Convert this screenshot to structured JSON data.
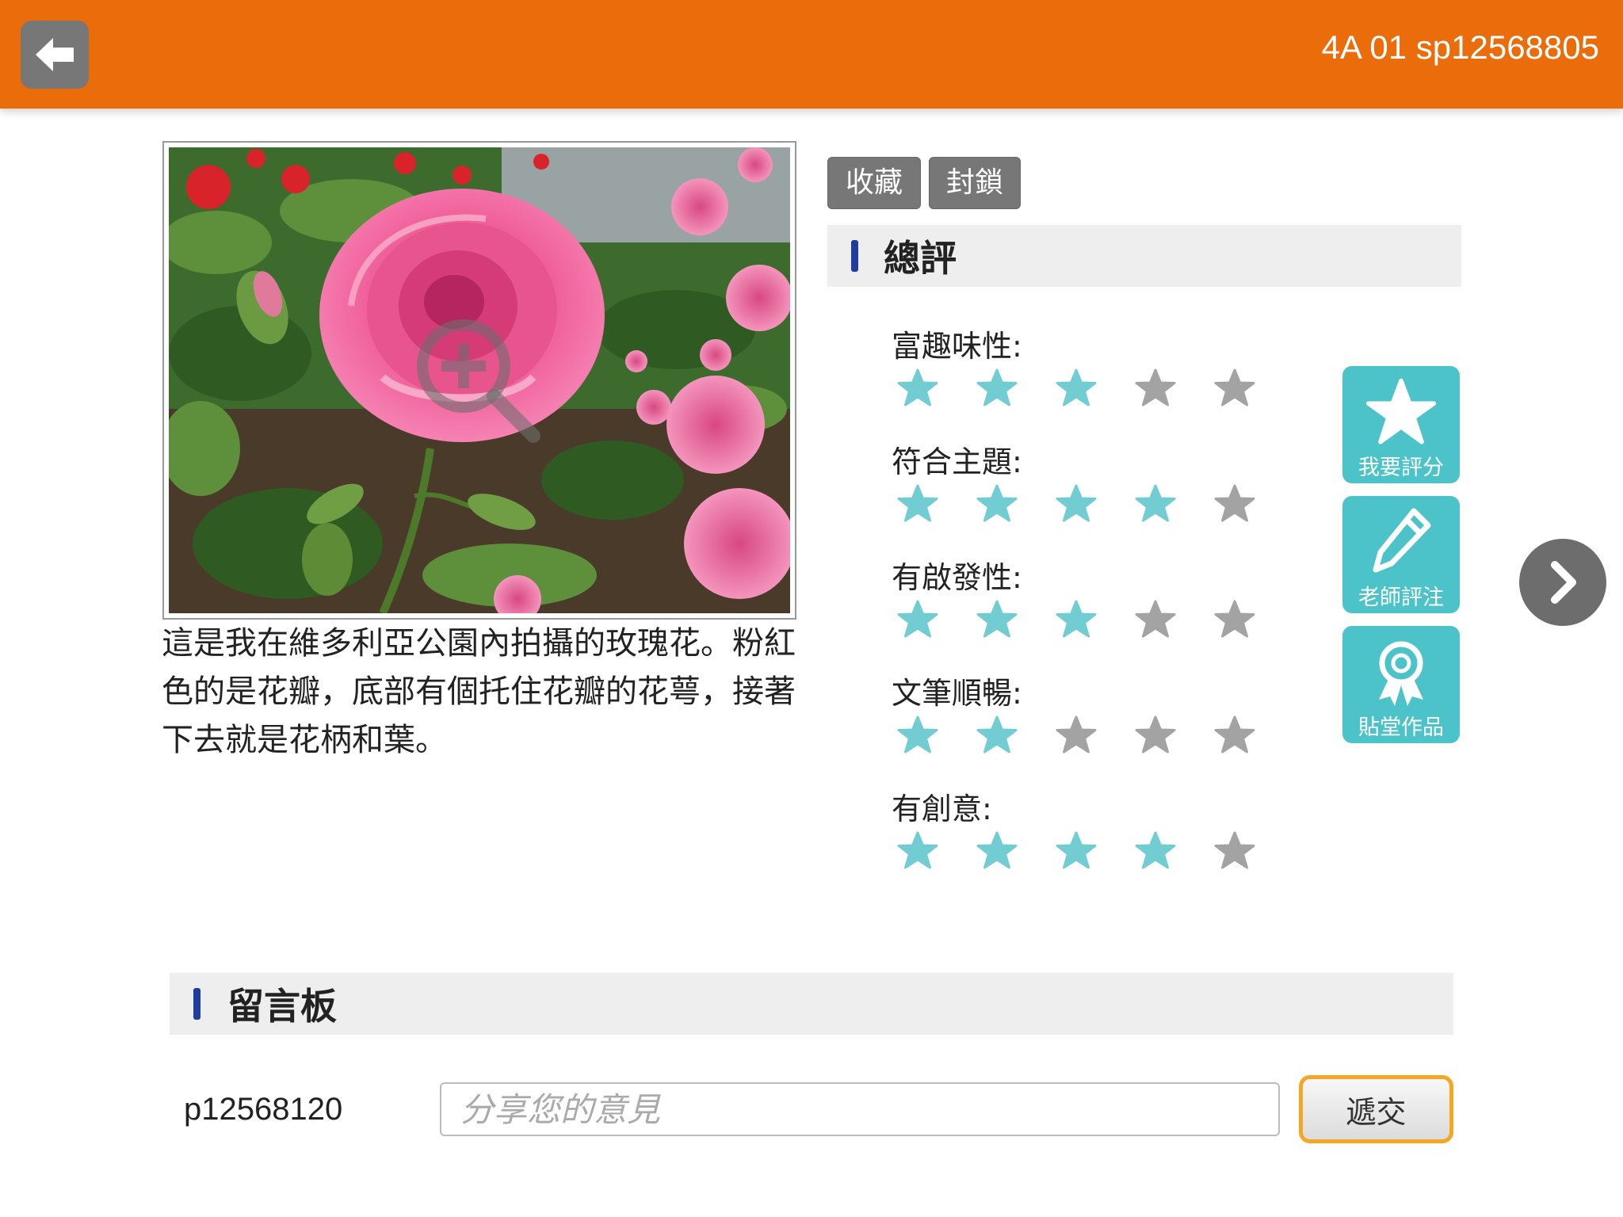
{
  "header": {
    "title": "4A 01 sp12568805",
    "back_icon": "arrow-left-icon"
  },
  "photo": {
    "zoom_icon": "zoom-in-icon",
    "caption": "這是我在維多利亞公園內拍攝的玫瑰花。粉紅色的是花瓣，底部有個托住花瓣的花萼，接著下去就是花柄和葉。"
  },
  "tags": {
    "favorite_label": "收藏",
    "block_label": "封鎖"
  },
  "rating": {
    "section_title": "總評",
    "criteria": [
      {
        "label": "富趣味性:",
        "score": 3,
        "max": 5
      },
      {
        "label": "符合主題:",
        "score": 4,
        "max": 5
      },
      {
        "label": "有啟發性:",
        "score": 3,
        "max": 5
      },
      {
        "label": "文筆順暢:",
        "score": 2,
        "max": 5
      },
      {
        "label": "有創意:",
        "score": 4,
        "max": 5
      }
    ],
    "filled_color": "#72cdd2",
    "empty_color": "#a3a3a3"
  },
  "actions": {
    "rate_label": "我要評分",
    "comment_label": "老師評注",
    "feature_label": "貼堂作品",
    "button_color": "#4cc3c9"
  },
  "navigation": {
    "next_icon": "chevron-right-icon"
  },
  "comments": {
    "section_title": "留言板",
    "user_id": "p12568120",
    "input_placeholder": "分享您的意見",
    "input_value": "",
    "submit_label": "遞交"
  },
  "colors": {
    "header_bg": "#ea6c0b",
    "accent_bar": "#1f3d9c",
    "submit_border": "#f5a623"
  }
}
